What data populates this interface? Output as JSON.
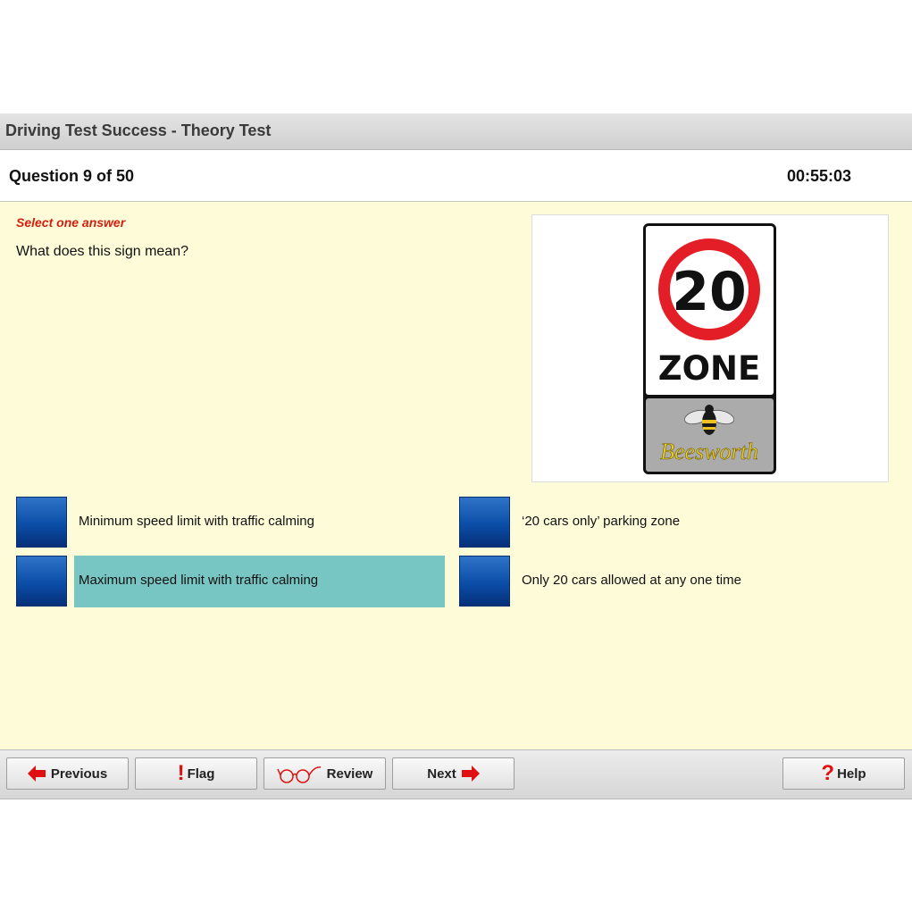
{
  "app": {
    "title": "Driving Test Success - Theory Test"
  },
  "question": {
    "counter": "Question 9 of 50",
    "timer": "00:55:03",
    "instruction": "Select one answer",
    "text": "What does this sign mean?"
  },
  "sign": {
    "speed": "20",
    "zone_label": "ZONE",
    "place_name": "Beesworth",
    "ring_color": "#e41e26",
    "place_color": "#f0d21e"
  },
  "answers": [
    {
      "label": "Minimum speed limit with traffic calming",
      "selected": false
    },
    {
      "label": "‘20 cars only’ parking zone",
      "selected": false
    },
    {
      "label": "Maximum speed limit with traffic calming",
      "selected": true
    },
    {
      "label": "Only 20 cars allowed at any one time",
      "selected": false
    }
  ],
  "footer": {
    "previous_label": "Previous",
    "flag_label": "Flag",
    "review_label": "Review",
    "next_label": "Next",
    "help_label": "Help"
  },
  "icons": {
    "previous": "arrow-left-icon",
    "flag": "exclamation-icon",
    "review": "glasses-icon",
    "next": "arrow-right-icon",
    "help": "question-mark-icon"
  },
  "colors": {
    "accent_red": "#e01010",
    "selected_answer": "#78c6c4",
    "answer_box": "#0b4ea8",
    "content_bg": "#fefbd8"
  }
}
